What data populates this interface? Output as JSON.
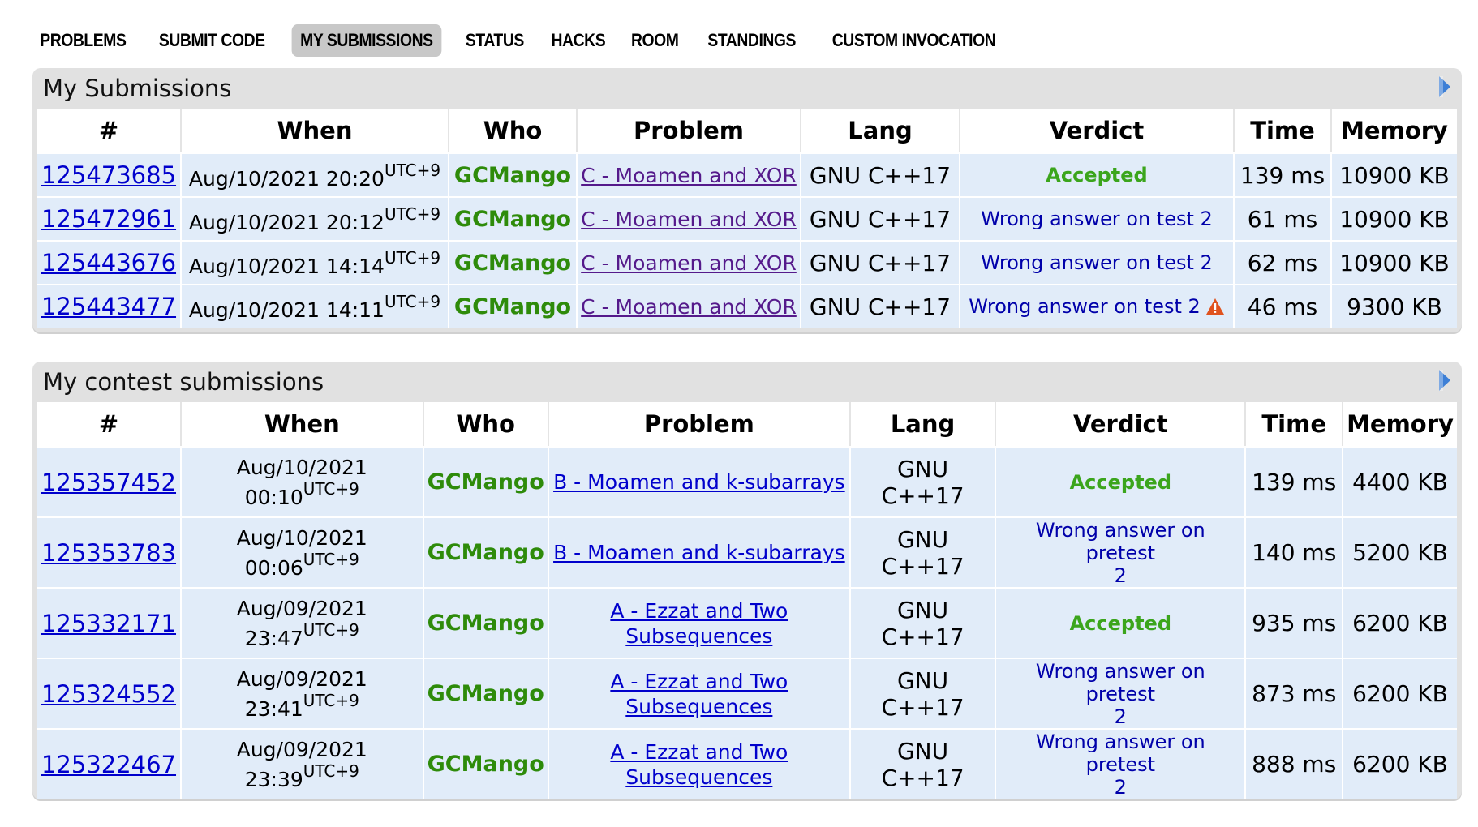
{
  "nav": [
    "PROBLEMS",
    "SUBMIT CODE",
    "MY SUBMISSIONS",
    "STATUS",
    "HACKS",
    "ROOM",
    "STANDINGS",
    "CUSTOM INVOCATION"
  ],
  "my_submissions": {
    "title": "My Submissions",
    "headers": [
      "#",
      "When",
      "Who",
      "Problem",
      "Lang",
      "Verdict",
      "Time",
      "Memory"
    ],
    "rows": [
      {
        "id": "125473685",
        "date": "Aug/10/2021 20:20",
        "tz": "UTC+9",
        "who": "GCMango",
        "problem": "C - Moamen and XOR",
        "lang": "GNU C++17",
        "verdict": "Accepted",
        "time": "139 ms",
        "memory": "10900 KB"
      },
      {
        "id": "125472961",
        "date": "Aug/10/2021 20:12",
        "tz": "UTC+9",
        "who": "GCMango",
        "problem": "C - Moamen and XOR",
        "lang": "GNU C++17",
        "verdict": "Wrong answer on test 2",
        "time": "61 ms",
        "memory": "10900 KB"
      },
      {
        "id": "125443676",
        "date": "Aug/10/2021 14:14",
        "tz": "UTC+9",
        "who": "GCMango",
        "problem": "C - Moamen and XOR",
        "lang": "GNU C++17",
        "verdict": "Wrong answer on test 2",
        "time": "62 ms",
        "memory": "10900 KB"
      },
      {
        "id": "125443477",
        "date": "Aug/10/2021 14:11",
        "tz": "UTC+9",
        "who": "GCMango",
        "problem": "C - Moamen and XOR",
        "lang": "GNU C++17",
        "verdict": "Wrong answer on test 2",
        "time": "46 ms",
        "memory": "9300 KB"
      }
    ]
  },
  "contest_submissions": {
    "title": "My contest submissions",
    "headers": [
      "#",
      "When",
      "Who",
      "Problem",
      "Lang",
      "Verdict",
      "Time",
      "Memory"
    ],
    "rows": [
      {
        "id": "125357452",
        "date1": "Aug/10/2021",
        "date2": "00:10",
        "tz": "UTC+9",
        "who": "GCMango",
        "prob1": "B - Moamen and k-subarrays",
        "prob2": "",
        "lang1": "GNU",
        "lang2": "C++17",
        "v1": "Accepted",
        "v2": "",
        "time": "139 ms",
        "memory": "4400 KB"
      },
      {
        "id": "125353783",
        "date1": "Aug/10/2021",
        "date2": "00:06",
        "tz": "UTC+9",
        "who": "GCMango",
        "prob1": "B - Moamen and k-subarrays",
        "prob2": "",
        "lang1": "GNU",
        "lang2": "C++17",
        "v1": "Wrong answer on pretest",
        "v2": "2",
        "time": "140 ms",
        "memory": "5200 KB"
      },
      {
        "id": "125332171",
        "date1": "Aug/09/2021",
        "date2": "23:47",
        "tz": "UTC+9",
        "who": "GCMango",
        "prob1": "A - Ezzat and Two",
        "prob2": "Subsequences",
        "lang1": "GNU",
        "lang2": "C++17",
        "v1": "Accepted",
        "v2": "",
        "time": "935 ms",
        "memory": "6200 KB"
      },
      {
        "id": "125324552",
        "date1": "Aug/09/2021",
        "date2": "23:41",
        "tz": "UTC+9",
        "who": "GCMango",
        "prob1": "A - Ezzat and Two",
        "prob2": "Subsequences",
        "lang1": "GNU",
        "lang2": "C++17",
        "v1": "Wrong answer on pretest",
        "v2": "2",
        "time": "873 ms",
        "memory": "6200 KB"
      },
      {
        "id": "125322467",
        "date1": "Aug/09/2021",
        "date2": "23:39",
        "tz": "UTC+9",
        "who": "GCMango",
        "prob1": "A - Ezzat and Two",
        "prob2": "Subsequences",
        "lang1": "GNU",
        "lang2": "C++17",
        "v1": "Wrong answer on pretest",
        "v2": "2",
        "time": "888 ms",
        "memory": "6200 KB"
      }
    ]
  },
  "colors": {
    "accepted": "#3ba51c",
    "wrong": "#0000aa",
    "who": "#2e8b0a",
    "row_bg": "#e1ecf9",
    "panel_bg": "#e1e1e1",
    "warn": "#e0531f"
  }
}
